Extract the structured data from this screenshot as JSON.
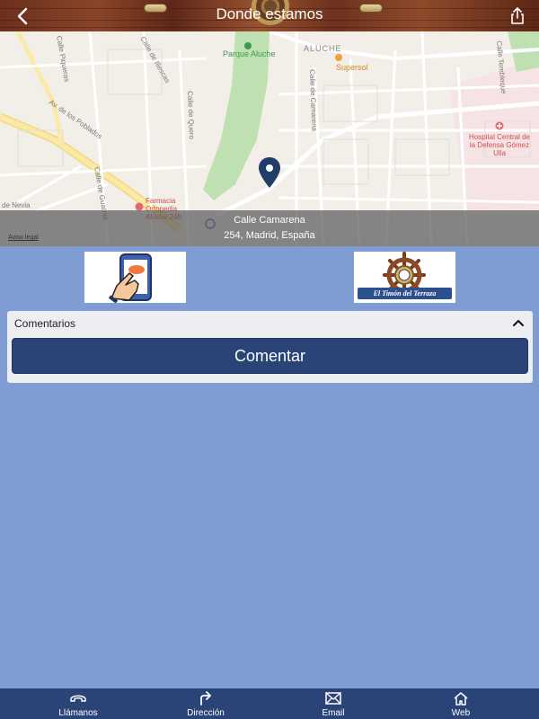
{
  "header": {
    "title": "Donde estamos",
    "back_icon": "chevron-left-icon",
    "share_icon": "share-icon"
  },
  "map": {
    "labels": {
      "park": "Parque Aluche",
      "district": "ALUCHE",
      "supermarket": "Supersol",
      "hospital": "Hospital Central de la Defensa Gómez Ulla",
      "pharmacy": "Farmacia Ortopedia Aluche 24h",
      "street_poblados": "Av. de los Poblados",
      "street_guarnia": "Calle de Guarnia",
      "street_camarena": "Calle de Camarena",
      "street_quero": "Calle de Quero",
      "street_illescas": "Calle de Illescas",
      "street_piqueras": "Calle Piqueras",
      "street_tembleque": "Calle Tembleque",
      "street_nevia": "de Nevia"
    },
    "address_line1": "Calle Camarena",
    "address_line2": "254, Madrid, España",
    "legal": "Aviso legal",
    "pin_icon": "map-pin-icon"
  },
  "buttons": {
    "contact_icon": "phone-tap-icon",
    "logo_text": "El Timón del Terraza"
  },
  "comments": {
    "title": "Comentarios",
    "action_label": "Comentar"
  },
  "tabbar": {
    "items": [
      {
        "label": "Llámanos",
        "icon": "phone-icon"
      },
      {
        "label": "Dirección",
        "icon": "direction-arrow-icon"
      },
      {
        "label": "Email",
        "icon": "envelope-icon"
      },
      {
        "label": "Web",
        "icon": "home-icon"
      }
    ]
  },
  "colors": {
    "background": "#7f9dd3",
    "primary": "#2a4478",
    "header_wood": "#7a3a22",
    "pin": "#233d6b"
  }
}
